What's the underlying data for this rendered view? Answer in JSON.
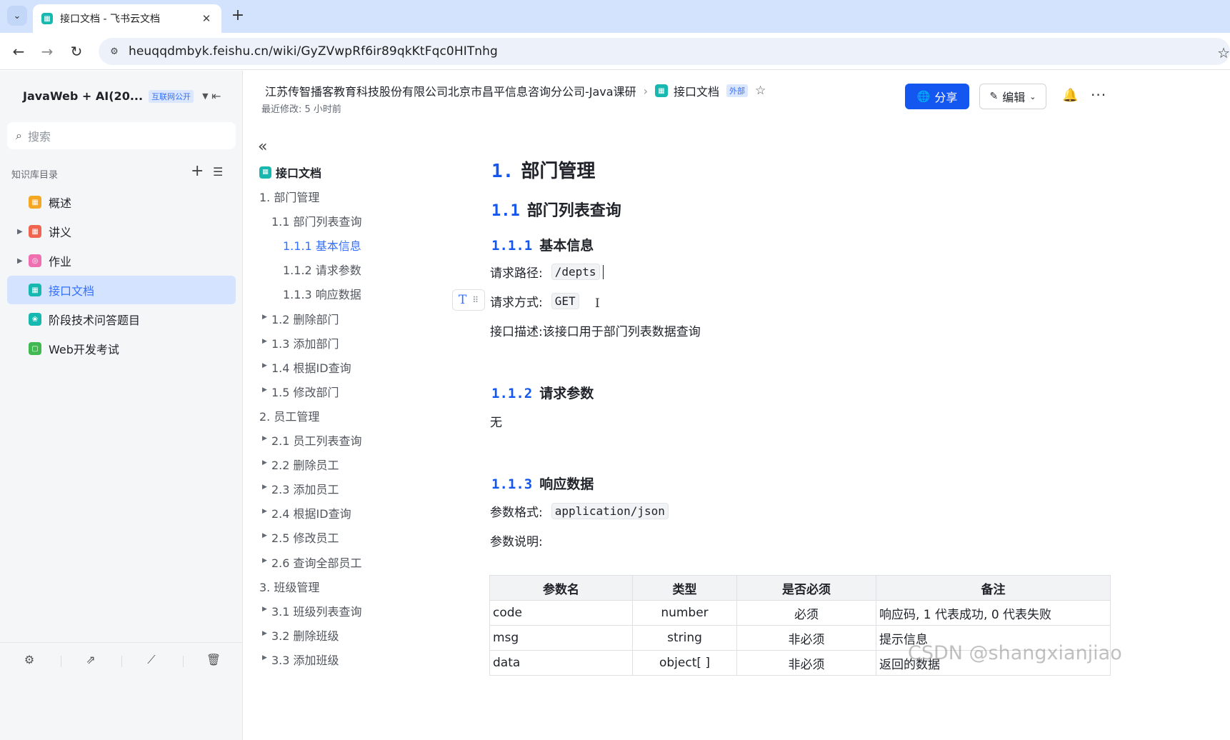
{
  "browser": {
    "tab_title": "接口文档 - 飞书云文档",
    "url": "heuqqdmbyk.feishu.cn/wiki/GyZVwpRf6ir89qkKtFqc0HITnhg"
  },
  "sidebar": {
    "title": "JavaWeb + AI(20...",
    "badge": "互联网公开",
    "search_placeholder": "搜索",
    "section_label": "知识库目录",
    "items": [
      {
        "label": "概述",
        "color": "#f5a623",
        "has_arrow": false
      },
      {
        "label": "讲义",
        "color": "#f0654f",
        "has_arrow": true
      },
      {
        "label": "作业",
        "color": "#f06fb0",
        "has_arrow": true
      },
      {
        "label": "接口文档",
        "color": "#17b8b0",
        "has_arrow": false,
        "active": true
      },
      {
        "label": "阶段技术问答题目",
        "color": "#17b8b0",
        "has_arrow": false
      },
      {
        "label": "Web开发考试",
        "color": "#3fb950",
        "has_arrow": false
      }
    ]
  },
  "header": {
    "org": "江苏传智播客教育科技股份有限公司北京市昌平信息咨询分公司-Java课研",
    "doc_title": "接口文档",
    "external_badge": "外部",
    "last_modified": "最近修改: 5 小时前",
    "share_label": "分享",
    "edit_label": "编辑"
  },
  "toc": {
    "doc_title": "接口文档",
    "items": [
      {
        "label": "1. 部门管理",
        "level": 0,
        "arrow": false
      },
      {
        "label": "1.1 部门列表查询",
        "level": 1,
        "arrow": false
      },
      {
        "label": "1.1.1 基本信息",
        "level": 2,
        "arrow": false,
        "active": true
      },
      {
        "label": "1.1.2 请求参数",
        "level": 2,
        "arrow": false
      },
      {
        "label": "1.1.3 响应数据",
        "level": 2,
        "arrow": false
      },
      {
        "label": "1.2 删除部门",
        "level": 1,
        "arrow": true
      },
      {
        "label": "1.3 添加部门",
        "level": 1,
        "arrow": true
      },
      {
        "label": "1.4 根据ID查询",
        "level": 1,
        "arrow": true
      },
      {
        "label": "1.5 修改部门",
        "level": 1,
        "arrow": true
      },
      {
        "label": "2. 员工管理",
        "level": 0,
        "arrow": false
      },
      {
        "label": "2.1 员工列表查询",
        "level": 1,
        "arrow": true
      },
      {
        "label": "2.2 删除员工",
        "level": 1,
        "arrow": true
      },
      {
        "label": "2.3 添加员工",
        "level": 1,
        "arrow": true
      },
      {
        "label": "2.4 根据ID查询",
        "level": 1,
        "arrow": true
      },
      {
        "label": "2.5 修改员工",
        "level": 1,
        "arrow": true
      },
      {
        "label": "2.6 查询全部员工",
        "level": 1,
        "arrow": true
      },
      {
        "label": "3. 班级管理",
        "level": 0,
        "arrow": false
      },
      {
        "label": "3.1 班级列表查询",
        "level": 1,
        "arrow": true
      },
      {
        "label": "3.2 删除班级",
        "level": 1,
        "arrow": true
      },
      {
        "label": "3.3 添加班级",
        "level": 1,
        "arrow": true
      }
    ]
  },
  "doc": {
    "h1_num": "1.",
    "h1_text": "部门管理",
    "h2_num": "1.1",
    "h2_text": "部门列表查询",
    "h3a_num": "1.1.1",
    "h3a_text": "基本信息",
    "path_label": "请求路径:",
    "path_value": "/depts",
    "method_label": "请求方式:",
    "method_value": "GET",
    "desc": "接口描述:该接口用于部门列表数据查询",
    "h3b_num": "1.1.2",
    "h3b_text": "请求参数",
    "none": "无",
    "h3c_num": "1.1.3",
    "h3c_text": "响应数据",
    "format_label": "参数格式:",
    "format_value": "application/json",
    "params_label": "参数说明:",
    "table": {
      "headers": [
        "参数名",
        "类型",
        "是否必须",
        "备注"
      ],
      "rows": [
        [
          "code",
          "number",
          "必须",
          "响应码, 1 代表成功, 0 代表失败"
        ],
        [
          "msg",
          "string",
          "非必须",
          "提示信息"
        ],
        [
          "data",
          "object[ ]",
          "非必须",
          "返回的数据"
        ]
      ]
    }
  },
  "watermark": "CSDN @shangxianjiao"
}
